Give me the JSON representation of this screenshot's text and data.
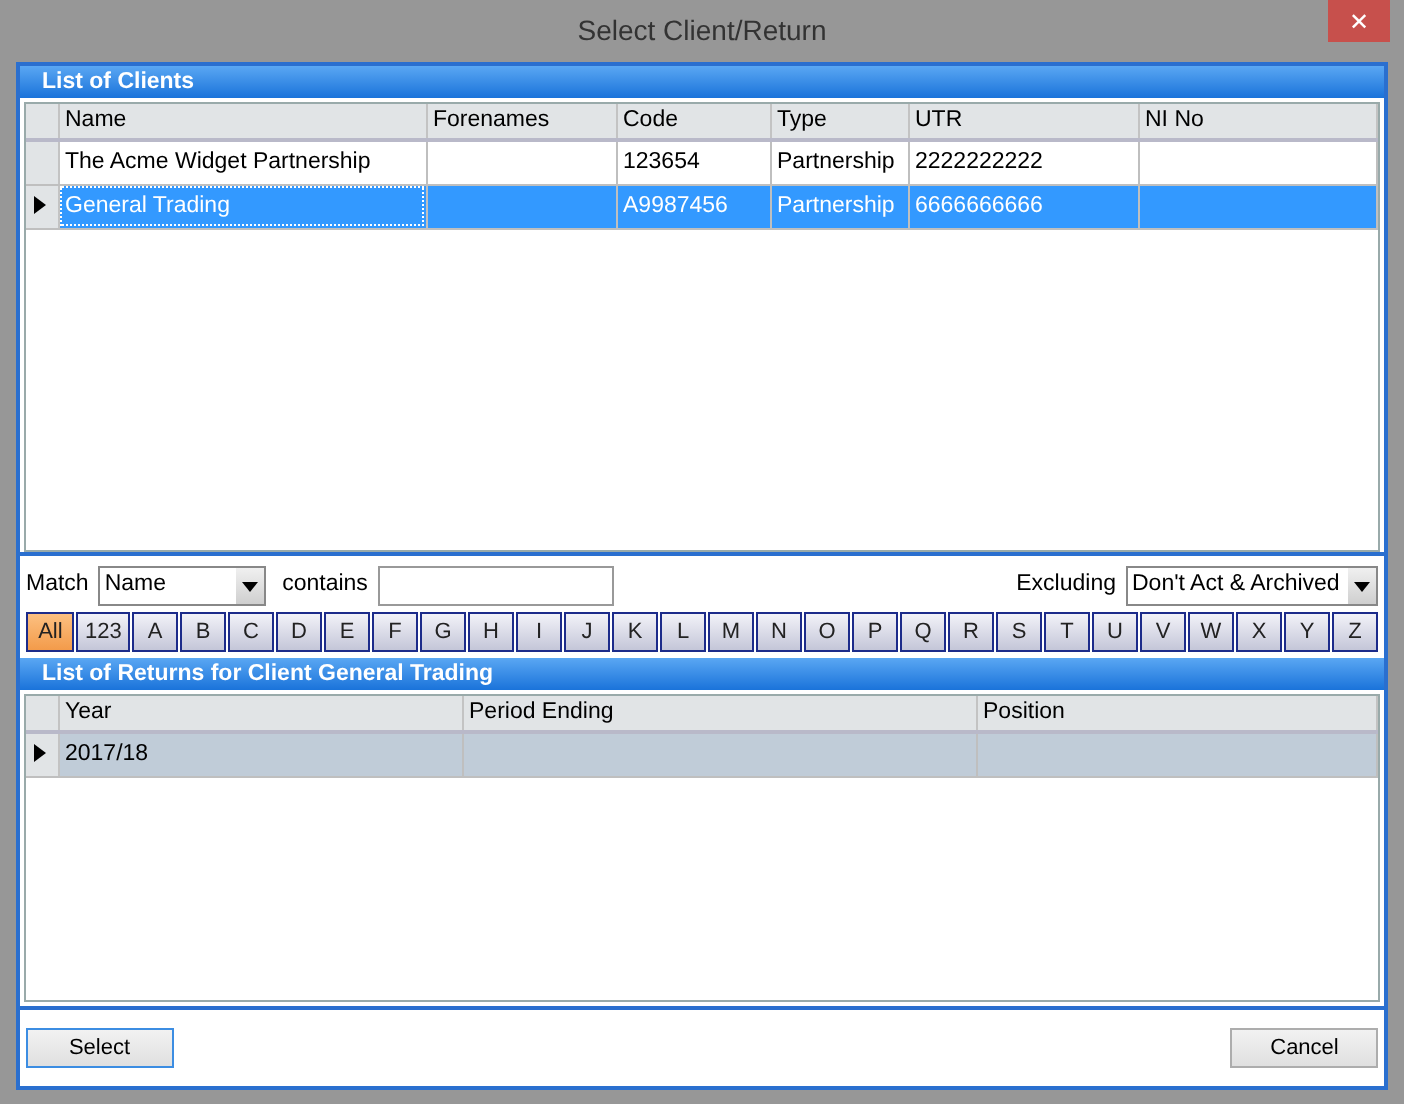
{
  "window": {
    "title": "Select Client/Return",
    "close": "✕"
  },
  "clients": {
    "title": "List of Clients",
    "columns": [
      "Name",
      "Forenames",
      "Code",
      "Type",
      "UTR",
      "NI No"
    ],
    "rows": [
      {
        "cells": [
          "The Acme Widget Partnership",
          null,
          "123654",
          "Partnership",
          "2222222222",
          null
        ],
        "selected": false
      },
      {
        "cells": [
          "General Trading",
          null,
          "A9987456",
          "Partnership",
          "6666666666",
          null
        ],
        "selected": true
      }
    ]
  },
  "filter": {
    "match_label": "Match",
    "match_value": "Name",
    "contains_label": "contains",
    "excluding_label": "Excluding",
    "excluding_value": "Don't Act & Archived",
    "letters": [
      {
        "label": "All",
        "selected": true
      },
      {
        "label": "123",
        "selected": false
      },
      {
        "label": "A",
        "selected": false
      },
      {
        "label": "B",
        "selected": false
      },
      {
        "label": "C",
        "selected": false
      },
      {
        "label": "D",
        "selected": false
      },
      {
        "label": "E",
        "selected": false
      },
      {
        "label": "F",
        "selected": false
      },
      {
        "label": "G",
        "selected": false
      },
      {
        "label": "H",
        "selected": false
      },
      {
        "label": "I",
        "selected": false
      },
      {
        "label": "J",
        "selected": false
      },
      {
        "label": "K",
        "selected": false
      },
      {
        "label": "L",
        "selected": false
      },
      {
        "label": "M",
        "selected": false
      },
      {
        "label": "N",
        "selected": false
      },
      {
        "label": "O",
        "selected": false
      },
      {
        "label": "P",
        "selected": false
      },
      {
        "label": "Q",
        "selected": false
      },
      {
        "label": "R",
        "selected": false
      },
      {
        "label": "S",
        "selected": false
      },
      {
        "label": "T",
        "selected": false
      },
      {
        "label": "U",
        "selected": false
      },
      {
        "label": "V",
        "selected": false
      },
      {
        "label": "W",
        "selected": false
      },
      {
        "label": "X",
        "selected": false
      },
      {
        "label": "Y",
        "selected": false
      },
      {
        "label": "Z",
        "selected": false
      }
    ]
  },
  "returns": {
    "title": "List of Returns for Client General Trading",
    "columns": [
      "Year",
      "Period Ending",
      "Position"
    ],
    "rows": [
      {
        "cells": [
          "2017/18",
          null,
          null
        ],
        "selected": true
      }
    ]
  },
  "buttons": [
    {
      "label": "Select",
      "kind": "default"
    },
    {
      "label": "Cancel",
      "kind": "normal"
    }
  ]
}
